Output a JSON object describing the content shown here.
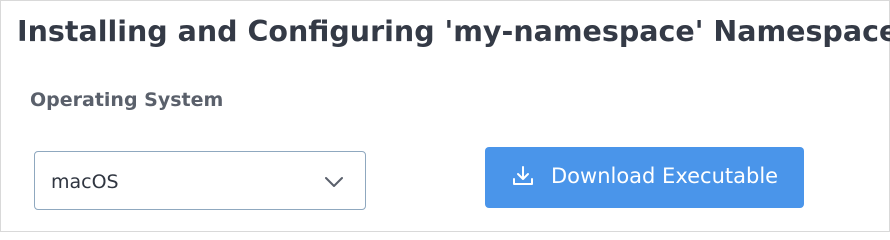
{
  "header": {
    "title": "Installing and Configuring 'my-namespace' Namespace"
  },
  "os_section": {
    "label": "Operating System",
    "select": {
      "selected_value": "macOS",
      "chevron_icon": "chevron-down-icon"
    }
  },
  "download": {
    "label": "Download Executable",
    "icon": "download-icon",
    "color": "#4a95ea"
  },
  "colors": {
    "title": "#343a46",
    "section_label": "#5a606b",
    "select_border": "#8fa8bf",
    "button_bg": "#4a95ea",
    "button_text": "#ffffff"
  }
}
